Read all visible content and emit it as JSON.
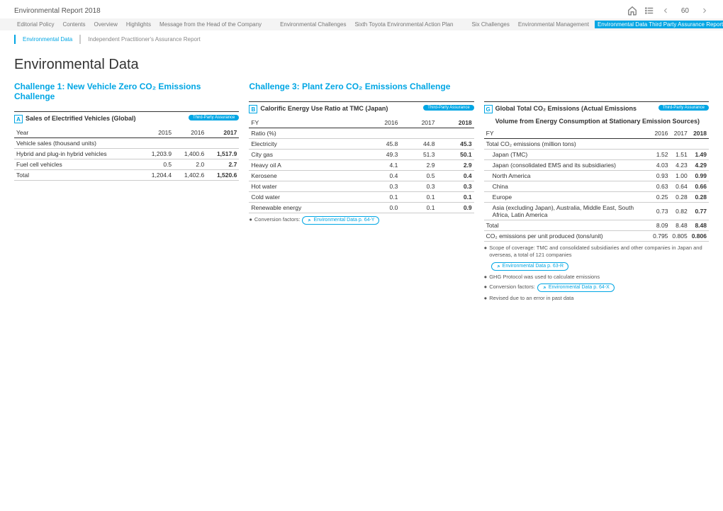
{
  "doc_title": "Environmental Report 2018",
  "page_num": "60",
  "nav": [
    "Editorial Policy",
    "Contents",
    "Overview",
    "Highlights",
    "Message from the Head of the Company",
    "Environmental Challenges",
    "Sixth Toyota Environmental Action Plan",
    "Six Challenges",
    "Environmental Management",
    "Environmental Data  Third Party Assurance Report"
  ],
  "subnav": [
    "Environmental Data",
    "Independent Practitioner's Assurance Report"
  ],
  "page_title": "Environmental Data",
  "challenge1_title": "Challenge 1: New Vehicle Zero CO₂ Emissions Challenge",
  "challenge3_title": "Challenge 3: Plant Zero CO₂ Emissions Challenge",
  "badge_text": "Third-Party Assurance",
  "tableA": {
    "letter": "A",
    "title": "Sales of Electrified Vehicles (Global)",
    "header": [
      "Year",
      "2015",
      "2016",
      "2017"
    ],
    "section": "Vehicle sales (thousand units)",
    "rows": [
      {
        "label": "Hybrid and plug-in hybrid vehicles",
        "v": [
          "1,203.9",
          "1,400.6",
          "1,517.9"
        ]
      },
      {
        "label": "Fuel cell vehicles",
        "v": [
          "0.5",
          "2.0",
          "2.7"
        ]
      },
      {
        "label": "Total",
        "v": [
          "1,204.4",
          "1,402.6",
          "1,520.6"
        ]
      }
    ]
  },
  "tableB": {
    "letter": "B",
    "title": "Calorific Energy Use Ratio at TMC (Japan)",
    "header": [
      "FY",
      "2016",
      "2017",
      "2018"
    ],
    "section": "Ratio (%)",
    "rows": [
      {
        "label": "Electricity",
        "v": [
          "45.8",
          "44.8",
          "45.3"
        ]
      },
      {
        "label": "City gas",
        "v": [
          "49.3",
          "51.3",
          "50.1"
        ]
      },
      {
        "label": "Heavy oil A",
        "v": [
          "4.1",
          "2.9",
          "2.9"
        ]
      },
      {
        "label": "Kerosene",
        "v": [
          "0.4",
          "0.5",
          "0.4"
        ]
      },
      {
        "label": "Hot water",
        "v": [
          "0.3",
          "0.3",
          "0.3"
        ]
      },
      {
        "label": "Cold water",
        "v": [
          "0.1",
          "0.1",
          "0.1"
        ]
      },
      {
        "label": "Renewable energy",
        "v": [
          "0.0",
          "0.1",
          "0.9"
        ]
      }
    ],
    "footnote": "Conversion factors:",
    "footnote_link": "Environmental Data p. 64-Y"
  },
  "tableG": {
    "letter": "G",
    "title": "Global Total CO₂ Emissions (Actual Emissions",
    "subtitle": "Volume from Energy Consumption at Stationary Emission Sources)",
    "header": [
      "FY",
      "2016",
      "2017",
      "2018"
    ],
    "section": "Total CO₂ emissions (million tons)",
    "rows": [
      {
        "label": "Japan (TMC)",
        "v": [
          "1.52",
          "1.51",
          "1.49"
        ],
        "indent": true
      },
      {
        "label": "Japan (consolidated EMS and its subsidiaries)",
        "v": [
          "4.03",
          "4.23",
          "4.29"
        ],
        "indent": true
      },
      {
        "label": "North America",
        "v": [
          "0.93",
          "1.00",
          "0.99"
        ],
        "indent": true
      },
      {
        "label": "China",
        "v": [
          "0.63",
          "0.64",
          "0.66"
        ],
        "indent": true
      },
      {
        "label": "Europe",
        "v": [
          "0.25",
          "0.28",
          "0.28"
        ],
        "indent": true
      },
      {
        "label": "Asia (excluding Japan), Australia, Middle East, South Africa, Latin America",
        "v": [
          "0.73",
          "0.82",
          "0.77"
        ],
        "indent": true
      },
      {
        "label": "Total",
        "v": [
          "8.09",
          "8.48",
          "8.48"
        ]
      },
      {
        "label": "CO₂ emissions per unit produced (tons/unit)",
        "v": [
          "0.795",
          "0.805",
          "0.806"
        ]
      }
    ],
    "footnotes": [
      {
        "text": "Scope of coverage: TMC and consolidated subsidiaries and other companies in Japan and overseas, a total of 121 companies",
        "link": "Environmental Data p. 63-R"
      },
      {
        "text": "GHG Protocol was used to calculate emissions"
      },
      {
        "text": "Conversion factors:",
        "link": "Environmental Data p. 64-X"
      },
      {
        "text": "Revised due to an error in past data"
      }
    ]
  }
}
